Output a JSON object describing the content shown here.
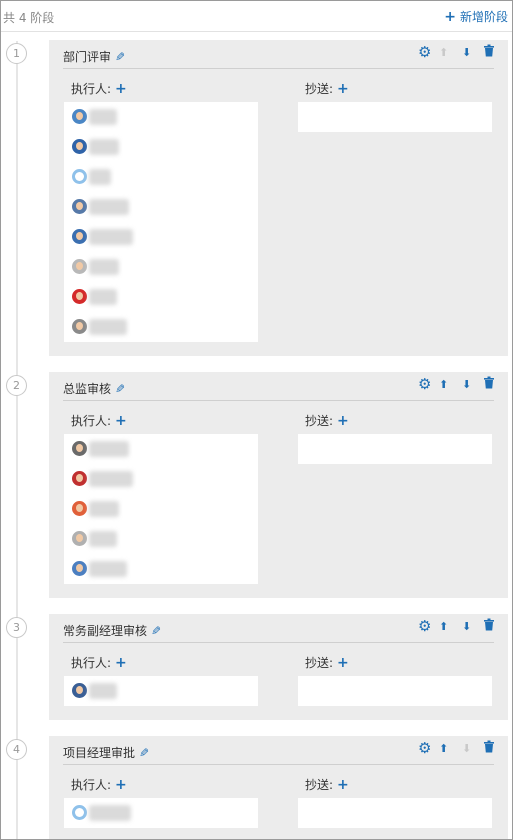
{
  "header": {
    "total_label": "共 4 阶段",
    "add_stage_label": "新增阶段",
    "add_icon": "plus-icon"
  },
  "labels": {
    "executor": "执行人:",
    "cc": "抄送:"
  },
  "colors": {
    "accent": "#1f6fb5",
    "disabled": "#c9c9c9",
    "stage_bg": "#ececec"
  },
  "stages": [
    {
      "number": "1",
      "title": "部门评审",
      "can_move_up": false,
      "can_move_down": true,
      "executors": [
        {
          "avatar": "#4a86c5"
        },
        {
          "avatar": "#2f63a8"
        },
        {
          "avatar": "#8fc1ea",
          "blank": true
        },
        {
          "avatar": "#5679a8"
        },
        {
          "avatar": "#3b6fb0"
        },
        {
          "avatar": "#b8b8b8"
        },
        {
          "avatar": "#d42a2a"
        },
        {
          "avatar": "#8a8a8a"
        }
      ]
    },
    {
      "number": "2",
      "title": "总监审核",
      "can_move_up": true,
      "can_move_down": true,
      "executors": [
        {
          "avatar": "#6a6a6a"
        },
        {
          "avatar": "#c03030"
        },
        {
          "avatar": "#e0603a"
        },
        {
          "avatar": "#b0b0b0"
        },
        {
          "avatar": "#4c7fc0"
        }
      ]
    },
    {
      "number": "3",
      "title": "常务副经理审核",
      "can_move_up": true,
      "can_move_down": true,
      "executors": [
        {
          "avatar": "#3a5f95"
        }
      ]
    },
    {
      "number": "4",
      "title": "项目经理审批",
      "can_move_up": true,
      "can_move_down": false,
      "executors": [
        {
          "avatar": "#8fc1ea",
          "blank": true
        }
      ]
    }
  ]
}
